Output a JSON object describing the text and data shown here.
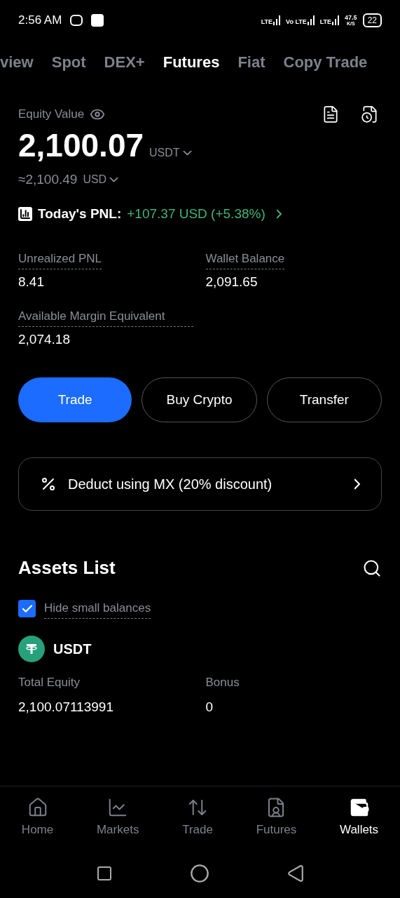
{
  "status_bar": {
    "time": "2:56 AM",
    "network": [
      "LTE",
      "Vo LTE",
      "LTE"
    ],
    "speed": "47.5",
    "speed_unit": "K/S",
    "battery": "22"
  },
  "tabs": [
    {
      "label": "view",
      "selected": false
    },
    {
      "label": "Spot",
      "selected": false
    },
    {
      "label": "DEX+",
      "selected": false
    },
    {
      "label": "Futures",
      "selected": true
    },
    {
      "label": "Fiat",
      "selected": false
    },
    {
      "label": "Copy Trade",
      "selected": false
    }
  ],
  "equity": {
    "label": "Equity Value",
    "value": "2,100.07",
    "currency": "USDT",
    "approx": "≈2,100.49",
    "approx_currency": "USD"
  },
  "pnl": {
    "label": "Today's PNL:",
    "value": "+107.37 USD (+5.38%)"
  },
  "stats": [
    {
      "label": "Unrealized PNL",
      "value": "8.41"
    },
    {
      "label": "Wallet Balance",
      "value": "2,091.65"
    },
    {
      "label": "Available Margin Equivalent",
      "value": "2,074.18"
    }
  ],
  "actions": [
    {
      "label": "Trade",
      "primary": true
    },
    {
      "label": "Buy Crypto",
      "primary": false
    },
    {
      "label": "Transfer",
      "primary": false
    }
  ],
  "deduct": {
    "label": "Deduct using MX (20% discount)"
  },
  "assets": {
    "title": "Assets List",
    "hide_small": {
      "label": "Hide small balances",
      "checked": true
    },
    "items": [
      {
        "symbol": "USDT",
        "fields": [
          {
            "label": "Total Equity",
            "value": "2,100.07113991"
          },
          {
            "label": "Bonus",
            "value": "0"
          }
        ]
      }
    ]
  },
  "bottom_nav": [
    {
      "label": "Home",
      "kind": "home",
      "selected": false
    },
    {
      "label": "Markets",
      "kind": "markets",
      "selected": false
    },
    {
      "label": "Trade",
      "kind": "trade",
      "selected": false
    },
    {
      "label": "Futures",
      "kind": "futures",
      "selected": false
    },
    {
      "label": "Wallets",
      "kind": "wallets",
      "selected": true
    }
  ]
}
